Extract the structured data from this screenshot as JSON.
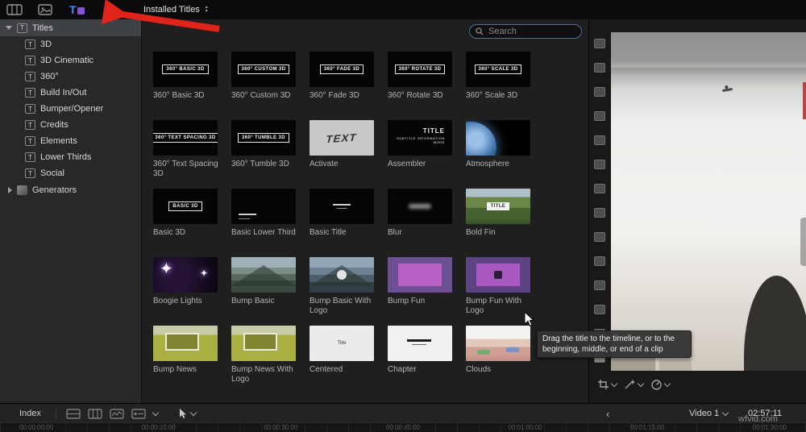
{
  "topbar": {
    "installed_titles_label": "Installed Titles",
    "icons": {
      "clips_browser": "filmstrip-icon",
      "photos_browser": "photos-icon",
      "titles_browser": "titles-generators-icon"
    }
  },
  "sidebar": {
    "root": {
      "label": "Titles"
    },
    "items": [
      {
        "label": "3D"
      },
      {
        "label": "3D Cinematic"
      },
      {
        "label": "360°"
      },
      {
        "label": "Build In/Out"
      },
      {
        "label": "Bumper/Opener"
      },
      {
        "label": "Credits"
      },
      {
        "label": "Elements"
      },
      {
        "label": "Lower Thirds"
      },
      {
        "label": "Social"
      }
    ],
    "generators": {
      "label": "Generators"
    }
  },
  "browser": {
    "search_placeholder": "Search",
    "items": [
      {
        "label": "360° Basic 3D",
        "thumb": "360° BASIC 3D"
      },
      {
        "label": "360° Custom 3D",
        "thumb": "360° CUSTOM 3D"
      },
      {
        "label": "360° Fade 3D",
        "thumb": "360° FADE 3D"
      },
      {
        "label": "360° Rotate 3D",
        "thumb": "360° ROTATE 3D"
      },
      {
        "label": "360° Scale 3D",
        "thumb": "360° SCALE 3D"
      },
      {
        "label": "360° Text Spacing 3D",
        "thumb": "360° TEXT SPACING 3D"
      },
      {
        "label": "360° Tumble 3D",
        "thumb": "360° TUMBLE 3D"
      },
      {
        "label": "Activate",
        "thumb": "TEXT"
      },
      {
        "label": "Assembler",
        "thumb": "TITLE",
        "thumb_sub": "SUBTITLE INFORMATION MORE"
      },
      {
        "label": "Atmosphere"
      },
      {
        "label": "Basic 3D",
        "thumb": "BASIC 3D"
      },
      {
        "label": "Basic Lower Third"
      },
      {
        "label": "Basic Title"
      },
      {
        "label": "Blur"
      },
      {
        "label": "Bold Fin",
        "thumb": "TITLE"
      },
      {
        "label": "Boogie Lights"
      },
      {
        "label": "Bump Basic"
      },
      {
        "label": "Bump Basic With Logo"
      },
      {
        "label": "Bump Fun"
      },
      {
        "label": "Bump Fun With Logo"
      },
      {
        "label": "Bump News"
      },
      {
        "label": "Bump News With Logo"
      },
      {
        "label": "Centered",
        "thumb": "Title"
      },
      {
        "label": "Chapter"
      },
      {
        "label": "Clouds"
      }
    ]
  },
  "tooltip": {
    "text": "Drag the title to the timeline, or to the beginning, middle, or end of a clip"
  },
  "bottombar": {
    "index_label": "Index",
    "video_track": "Video 1",
    "timecode": "02:57:11"
  },
  "ruler": {
    "labels": [
      "00:00:00:00",
      "00:00:15:00",
      "00:00:30:00",
      "00:00:45:00",
      "00:01:00:00",
      "00:01:15:00",
      "00:01:30:00"
    ]
  },
  "watermark": "wfvid.com",
  "colors": {
    "annotation_arrow": "#e0241a",
    "search_focus_border": "#46719f",
    "selected_row": "#3f4244"
  }
}
